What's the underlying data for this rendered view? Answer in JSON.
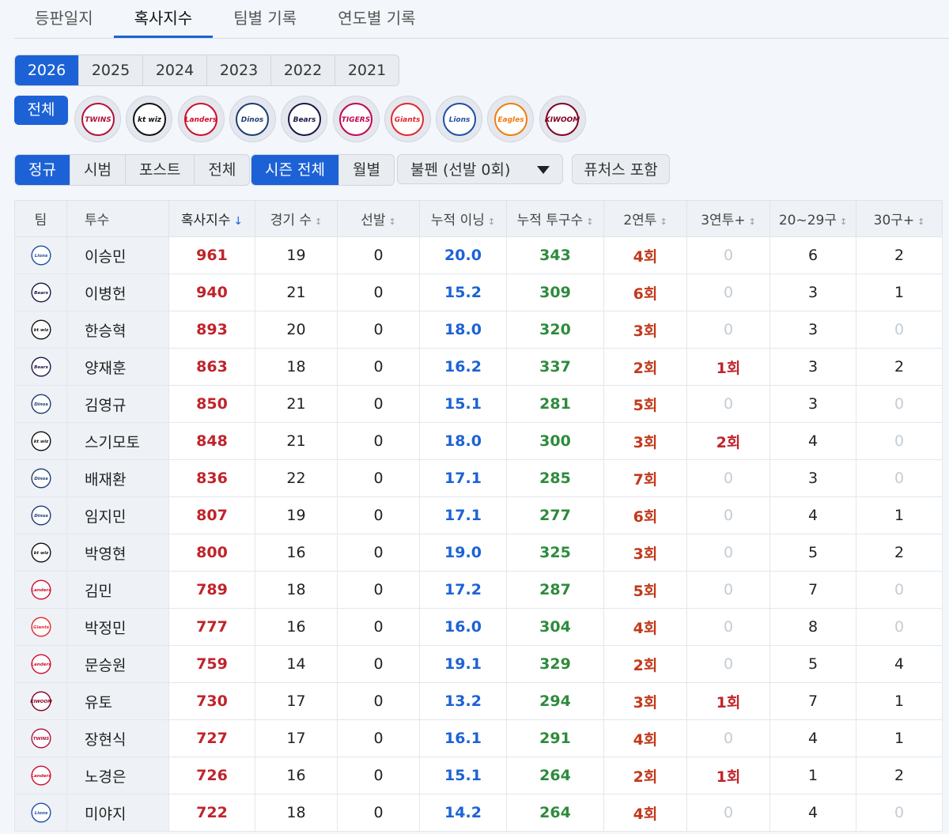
{
  "tabs": [
    "등판일지",
    "혹사지수",
    "팀별 기록",
    "연도별 기록"
  ],
  "active_tab": 1,
  "years": [
    "2026",
    "2025",
    "2024",
    "2023",
    "2022",
    "2021"
  ],
  "active_year": 0,
  "teams": {
    "all_label": "전체",
    "logos": [
      {
        "name": "twins",
        "text": "TWINS",
        "color": "#b0113a"
      },
      {
        "name": "ktwiz",
        "text": "kt wiz",
        "color": "#111111"
      },
      {
        "name": "landers",
        "text": "Landers",
        "color": "#ce0e2d"
      },
      {
        "name": "dinos",
        "text": "Dinos",
        "color": "#1d3e74"
      },
      {
        "name": "bears",
        "text": "Bears",
        "color": "#1a1748"
      },
      {
        "name": "tigers",
        "text": "TIGERS",
        "color": "#c30452"
      },
      {
        "name": "giants",
        "text": "Giants",
        "color": "#e0282e"
      },
      {
        "name": "lions",
        "text": "Lions",
        "color": "#1e4fa4"
      },
      {
        "name": "eagles",
        "text": "Eagles",
        "color": "#f07c10"
      },
      {
        "name": "kiwoom",
        "text": "KIWOOM",
        "color": "#820024"
      }
    ]
  },
  "filters": {
    "game_type": [
      "정규",
      "시범",
      "포스트",
      "전체"
    ],
    "period": [
      "시즌 전체",
      "월별"
    ],
    "role_dropdown": "불펜 (선발 0회)",
    "futures_label": "퓨처스 포함"
  },
  "table": {
    "headers": [
      "팀",
      "투수",
      "혹사지수",
      "경기 수",
      "선발",
      "누적 이닝",
      "누적 투구수",
      "2연투",
      "3연투+",
      "20~29구",
      "30구+"
    ],
    "rows": [
      {
        "team": "lions",
        "name": "이승민",
        "index": "961",
        "games": "19",
        "starts": "0",
        "innings": "20.0",
        "pitches": "343",
        "b2b": "4회",
        "b3": "0",
        "p20": "6",
        "p30": "2"
      },
      {
        "team": "bears",
        "name": "이병헌",
        "index": "940",
        "games": "21",
        "starts": "0",
        "innings": "15.2",
        "pitches": "309",
        "b2b": "6회",
        "b3": "0",
        "p20": "3",
        "p30": "1"
      },
      {
        "team": "ktwiz",
        "name": "한승혁",
        "index": "893",
        "games": "20",
        "starts": "0",
        "innings": "18.0",
        "pitches": "320",
        "b2b": "3회",
        "b3": "0",
        "p20": "3",
        "p30": "0"
      },
      {
        "team": "bears",
        "name": "양재훈",
        "index": "863",
        "games": "18",
        "starts": "0",
        "innings": "16.2",
        "pitches": "337",
        "b2b": "2회",
        "b3": "1회",
        "p20": "3",
        "p30": "2"
      },
      {
        "team": "dinos",
        "name": "김영규",
        "index": "850",
        "games": "21",
        "starts": "0",
        "innings": "15.1",
        "pitches": "281",
        "b2b": "5회",
        "b3": "0",
        "p20": "3",
        "p30": "0"
      },
      {
        "team": "ktwiz",
        "name": "스기모토",
        "index": "848",
        "games": "21",
        "starts": "0",
        "innings": "18.0",
        "pitches": "300",
        "b2b": "3회",
        "b3": "2회",
        "p20": "4",
        "p30": "0"
      },
      {
        "team": "dinos",
        "name": "배재환",
        "index": "836",
        "games": "22",
        "starts": "0",
        "innings": "17.1",
        "pitches": "285",
        "b2b": "7회",
        "b3": "0",
        "p20": "3",
        "p30": "0"
      },
      {
        "team": "dinos",
        "name": "임지민",
        "index": "807",
        "games": "19",
        "starts": "0",
        "innings": "17.1",
        "pitches": "277",
        "b2b": "6회",
        "b3": "0",
        "p20": "4",
        "p30": "1"
      },
      {
        "team": "ktwiz",
        "name": "박영현",
        "index": "800",
        "games": "16",
        "starts": "0",
        "innings": "19.0",
        "pitches": "325",
        "b2b": "3회",
        "b3": "0",
        "p20": "5",
        "p30": "2"
      },
      {
        "team": "landers",
        "name": "김민",
        "index": "789",
        "games": "18",
        "starts": "0",
        "innings": "17.2",
        "pitches": "287",
        "b2b": "5회",
        "b3": "0",
        "p20": "7",
        "p30": "0"
      },
      {
        "team": "giants",
        "name": "박정민",
        "index": "777",
        "games": "16",
        "starts": "0",
        "innings": "16.0",
        "pitches": "304",
        "b2b": "4회",
        "b3": "0",
        "p20": "8",
        "p30": "0"
      },
      {
        "team": "landers",
        "name": "문승원",
        "index": "759",
        "games": "14",
        "starts": "0",
        "innings": "19.1",
        "pitches": "329",
        "b2b": "2회",
        "b3": "0",
        "p20": "5",
        "p30": "4"
      },
      {
        "team": "kiwoom",
        "name": "유토",
        "index": "730",
        "games": "17",
        "starts": "0",
        "innings": "13.2",
        "pitches": "294",
        "b2b": "3회",
        "b3": "1회",
        "p20": "7",
        "p30": "1"
      },
      {
        "team": "twins",
        "name": "장현식",
        "index": "727",
        "games": "17",
        "starts": "0",
        "innings": "16.1",
        "pitches": "291",
        "b2b": "4회",
        "b3": "0",
        "p20": "4",
        "p30": "1"
      },
      {
        "team": "landers",
        "name": "노경은",
        "index": "726",
        "games": "16",
        "starts": "0",
        "innings": "15.1",
        "pitches": "264",
        "b2b": "2회",
        "b3": "1회",
        "p20": "1",
        "p30": "2"
      },
      {
        "team": "lions",
        "name": "미야지",
        "index": "722",
        "games": "18",
        "starts": "0",
        "innings": "14.2",
        "pitches": "264",
        "b2b": "4회",
        "b3": "0",
        "p20": "4",
        "p30": "0"
      }
    ]
  }
}
